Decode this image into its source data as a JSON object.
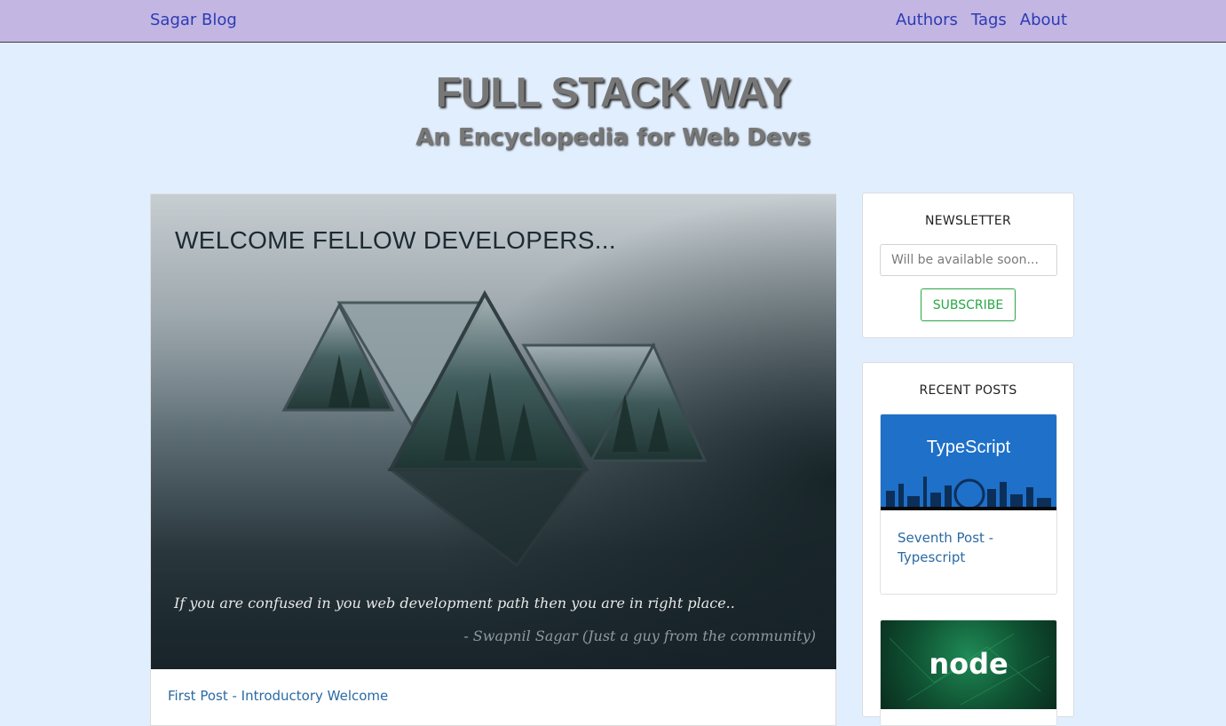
{
  "navbar": {
    "brand": "Sagar Blog",
    "links": [
      "Authors",
      "Tags",
      "About"
    ],
    "background": "#c3b6e2",
    "link_color": "#2c3bb4"
  },
  "header": {
    "title": "FULL STACK WAY",
    "subtitle": "An Encyclopedia for Web Devs"
  },
  "main_post": {
    "hero_heading": "WELCOME FELLOW DEVELOPERS...",
    "hero_quote": "If you are confused in you web development path then you are in right place..",
    "hero_attribution": "- Swapnil Sagar  (Just a guy from the community)",
    "link_text": "First Post - Introductory Welcome"
  },
  "newsletter": {
    "title": "NEWSLETTER",
    "input_placeholder": "Will be available soon...",
    "button_label": "SUBSCRIBE",
    "button_color": "#28a745"
  },
  "recent_posts": {
    "title": "RECENT POSTS",
    "items": [
      {
        "thumb_label": "TypeScript",
        "link_text": "Seventh Post - Typescript"
      },
      {
        "thumb_label": "node"
      }
    ]
  }
}
